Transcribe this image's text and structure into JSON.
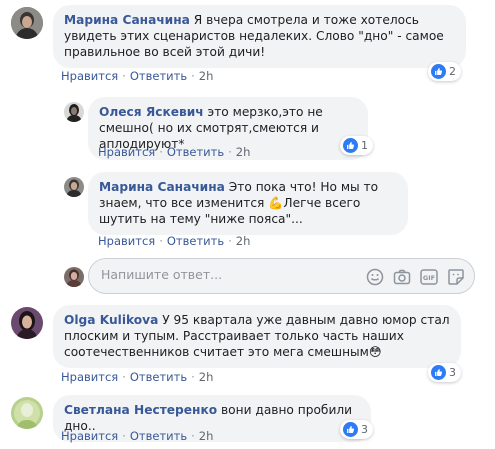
{
  "comments": [
    {
      "author": "Марина Саначина",
      "text": "Я вчера смотрела и тоже хотелось увидеть этих сценаристов недалеких. Слово \"дно\" - самое правильное во всей этой дичи!",
      "like": "Нравится",
      "reply": "Ответить",
      "time": "2h",
      "reactions": "2"
    },
    {
      "author": "Олеся Яскевич",
      "text": "это мерзко,это не смешно( но их смотрят,смеются и аплодируют*",
      "like": "Нравится",
      "reply": "Ответить",
      "time": "2h",
      "reactions": "1"
    },
    {
      "author": "Марина Саначина",
      "text_before": "Это пока что! Но мы то знаем, что все изменится ",
      "emoji": "💪",
      "text_after": "Легче всего шутить на тему \"ниже пояса\"...",
      "like": "Нравится",
      "reply": "Ответить",
      "time": "2h"
    },
    {
      "author": "Olga Kulikova",
      "text": "У 95 квартала уже давным давно юмор стал плоским и тупым. Расстраивает только часть наших соотечественников считает это мега смешным",
      "emoji": "😳",
      "like": "Нравится",
      "reply": "Ответить",
      "time": "2h",
      "reactions": "3"
    },
    {
      "author": "Светлана Нестеренко",
      "text": "вони давно пробили дно..",
      "like": "Нравится",
      "reply": "Ответить",
      "time": "2h",
      "reactions": "3"
    }
  ],
  "reply_box": {
    "placeholder": "Напишите ответ..."
  },
  "icons": {
    "reply_box": [
      "emoji-icon",
      "camera-icon",
      "gif-icon",
      "sticker-icon"
    ],
    "reaction": "like-icon"
  },
  "colors": {
    "link": "#385898",
    "bubble": "#f2f3f5",
    "like_blue": "#2e7bf6",
    "meta": "#606770"
  }
}
